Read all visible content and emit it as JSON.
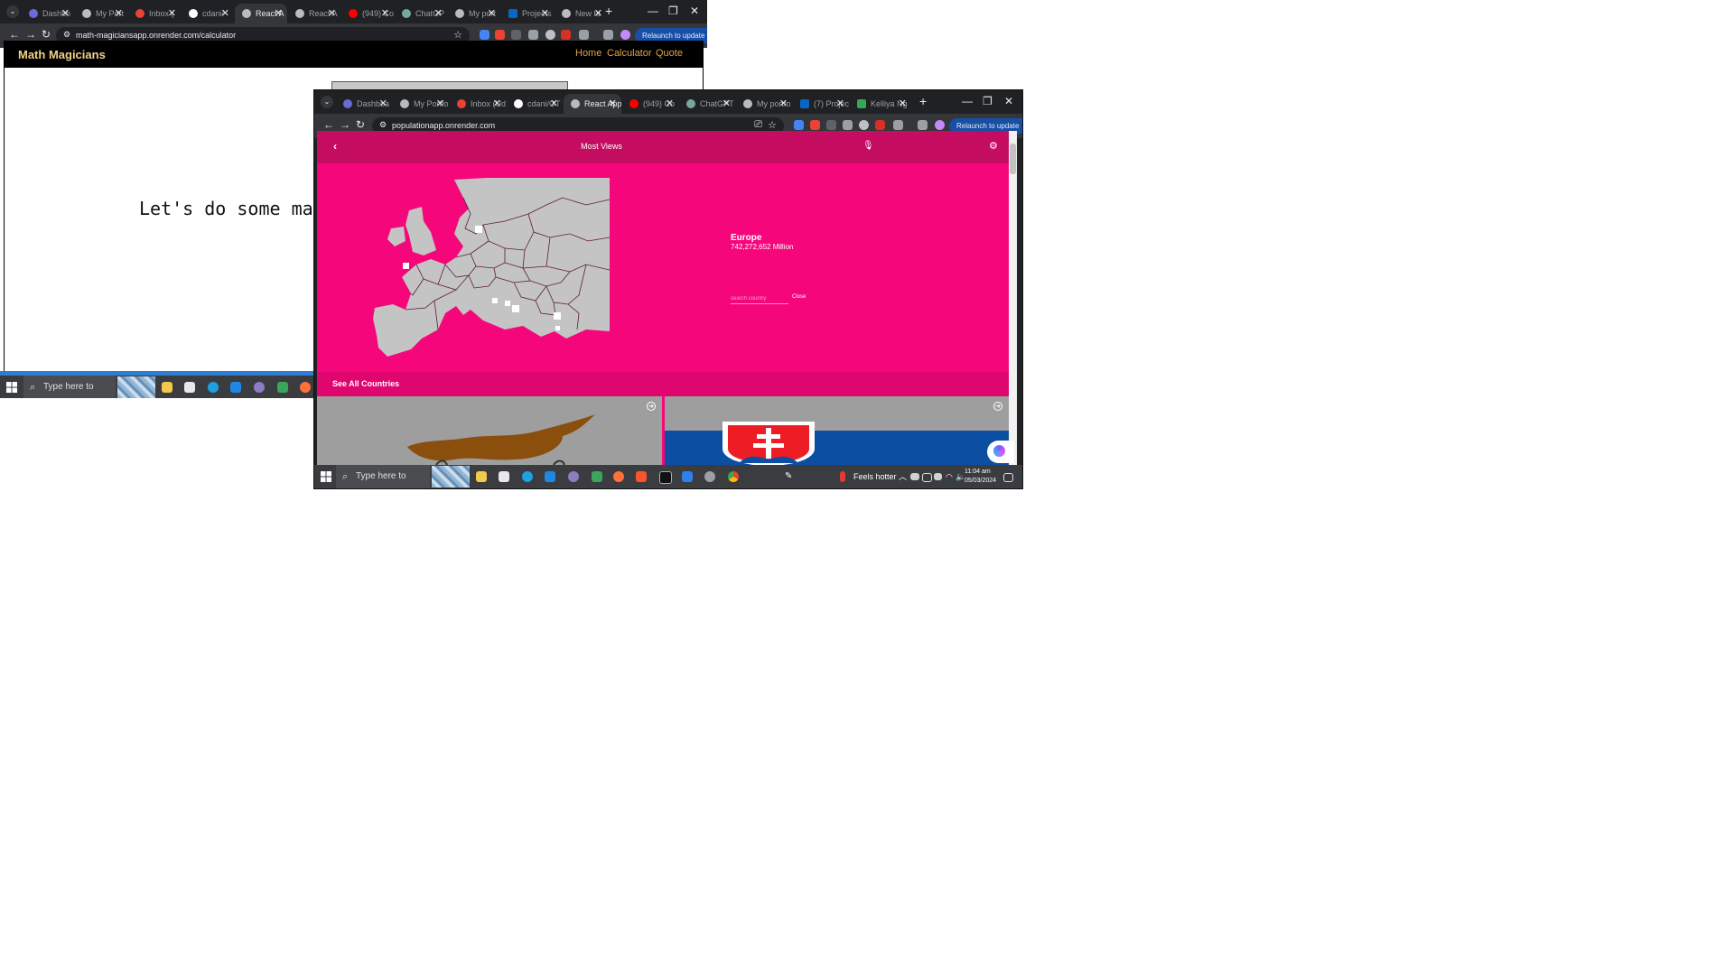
{
  "back_window": {
    "tabs": [
      "Dashbo",
      "My Port",
      "Inbox (",
      "cdani/",
      "React A",
      "React A",
      "(949) Co",
      "ChatGP",
      "My port",
      "Projects",
      "New ta"
    ],
    "active_tab_index": 4,
    "url": "math-magiciansapp.onrender.com/calculator",
    "relaunch_label": "Relaunch to update",
    "brand": "Math Magicians",
    "nav": [
      "Home",
      "Calculator",
      "Quote"
    ],
    "hero_text": "Let's do some mat",
    "taskbar_search": "Type here to search"
  },
  "front_window": {
    "tabs": [
      "Dashboa",
      "My Portfo",
      "Inbox (Ud",
      "cdani/OT",
      "React App",
      "(949) Co",
      "ChatGPT",
      "My portfo",
      "(7) Project",
      "Kelliya Ng"
    ],
    "active_tab_index": 4,
    "url": "populationapp.onrender.com",
    "relaunch_label": "Relaunch to update",
    "app": {
      "header_title": "Most Views",
      "region_name": "Europe",
      "region_population": "742,272,652 Million",
      "search_placeholder": "search country",
      "close_label": "Close",
      "see_all_label": "See All Countries",
      "cards": [
        "Cyprus",
        "Slovakia"
      ]
    },
    "taskbar": {
      "search": "Type here to search",
      "weather": "Feels hotter",
      "time": "11:04 am",
      "date": "05/03/2024"
    }
  },
  "colors": {
    "app_background": "#f5077b",
    "app_header": "#c40d61",
    "see_all_bar": "#e0066f",
    "map_land": "#c4c4c4",
    "brand_gold": "#f1d18a",
    "nav_orange": "#e0a446",
    "chrome_dark": "#202124",
    "relaunch_blue": "#174ea6"
  }
}
